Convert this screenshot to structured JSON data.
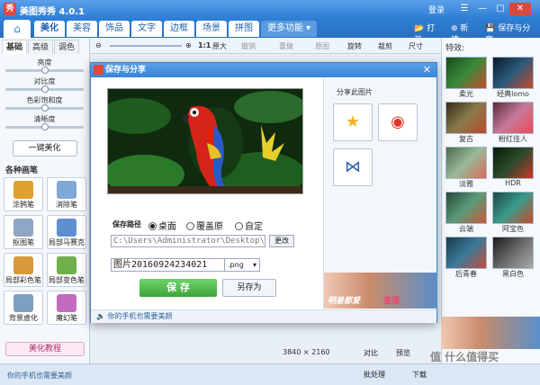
{
  "app": {
    "title": "美图秀秀 4.0.1",
    "logo": "秀",
    "login": "登录"
  },
  "window_controls": {
    "menu": "☰",
    "minimize": "—",
    "maximize": "□",
    "close": "✕"
  },
  "main_tabs": [
    {
      "label": "美化",
      "active": true
    },
    {
      "label": "美容"
    },
    {
      "label": "饰品"
    },
    {
      "label": "文字"
    },
    {
      "label": "边框"
    },
    {
      "label": "场景"
    },
    {
      "label": "拼图"
    },
    {
      "label": "更多功能 ▾",
      "more": true
    }
  ],
  "top_actions": {
    "open": "打开",
    "new": "新建",
    "save_share": "保存与分享"
  },
  "left_panel": {
    "subtabs": [
      "基础",
      "高级",
      "调色"
    ],
    "sliders": [
      {
        "label": "亮度",
        "value": 0.5
      },
      {
        "label": "对比度",
        "value": 0.5
      },
      {
        "label": "色彩饱和度",
        "value": 0.5
      },
      {
        "label": "清晰度",
        "value": 0.5
      }
    ],
    "one_click": "一键美化",
    "section_title": "各种画笔",
    "brushes": [
      {
        "label": "涂鸦笔",
        "color": "#e0a030"
      },
      {
        "label": "消除笔",
        "color": "#7fa8d8"
      },
      {
        "label": "抠图笔",
        "color": "#8fa6c4"
      },
      {
        "label": "局部马赛克",
        "color": "#5f8fd0"
      },
      {
        "label": "局部彩色笔",
        "color": "#d89a3a"
      },
      {
        "label": "局部变色笔",
        "color": "#6fb04a"
      },
      {
        "label": "背景虚化",
        "color": "#7ea0c0"
      },
      {
        "label": "魔幻笔",
        "color": "#c46abf"
      }
    ],
    "tutorial": "美化教程"
  },
  "edit_toolbar": {
    "zoom_ratio": "1:1",
    "original_size": "原大",
    "undo": "撤销",
    "redo": "重做",
    "reset": "原图",
    "rotate": "旋转",
    "crop": "裁剪",
    "size": "尺寸"
  },
  "right_panel": {
    "title": "特效:",
    "effects": [
      {
        "label": "柔光",
        "color": "#2b6a2b"
      },
      {
        "label": "经典lomo",
        "color": "#1e3d5a"
      },
      {
        "label": "复古",
        "color": "#6d5a3a"
      },
      {
        "label": "粉红佳人",
        "color": "#a85a7a"
      },
      {
        "label": "淡雅",
        "color": "#6a8a6a"
      },
      {
        "label": "HDR",
        "color": "#1a3a1a"
      },
      {
        "label": "云端",
        "color": "#3a6a4a"
      },
      {
        "label": "阿宝色",
        "color": "#3a7a6a"
      },
      {
        "label": "后青春",
        "color": "#2a5a6a"
      },
      {
        "label": "黑白色",
        "color": "#4a4a4a"
      }
    ]
  },
  "canvas": {
    "dimensions": "3840 × 2160"
  },
  "status": {
    "compare": "对比",
    "preview": "预览",
    "mine": "你的手机也需要美颜",
    "batch": "批处理",
    "download": "下载"
  },
  "watermark": "值 什么值得买",
  "dialog": {
    "title": "保存与分享",
    "close": "✕",
    "path_label": "保存路径",
    "radio_options": [
      {
        "label": "桌面",
        "selected": true
      },
      {
        "label": "覆盖原",
        "selected": false
      },
      {
        "label": "自定",
        "selected": false
      }
    ],
    "path_value": "C:\\Users\\Administrator\\Desktop\\",
    "change_button": "更改",
    "filename": "图片20160924234021 ",
    "format": ".png",
    "save_button": "保 存",
    "saveas_button": "另存为",
    "footer": "你的手机也需要美颜",
    "share_label": "分享此图片",
    "share_icons": [
      "star-icon",
      "weibo-icon",
      "renren-icon"
    ],
    "ad_text": "明星都爱",
    "ad_live": "直播"
  },
  "colors": {
    "accent": "#2f7fd6",
    "save_green": "#4cb84a",
    "close_red": "#d94a3a"
  }
}
